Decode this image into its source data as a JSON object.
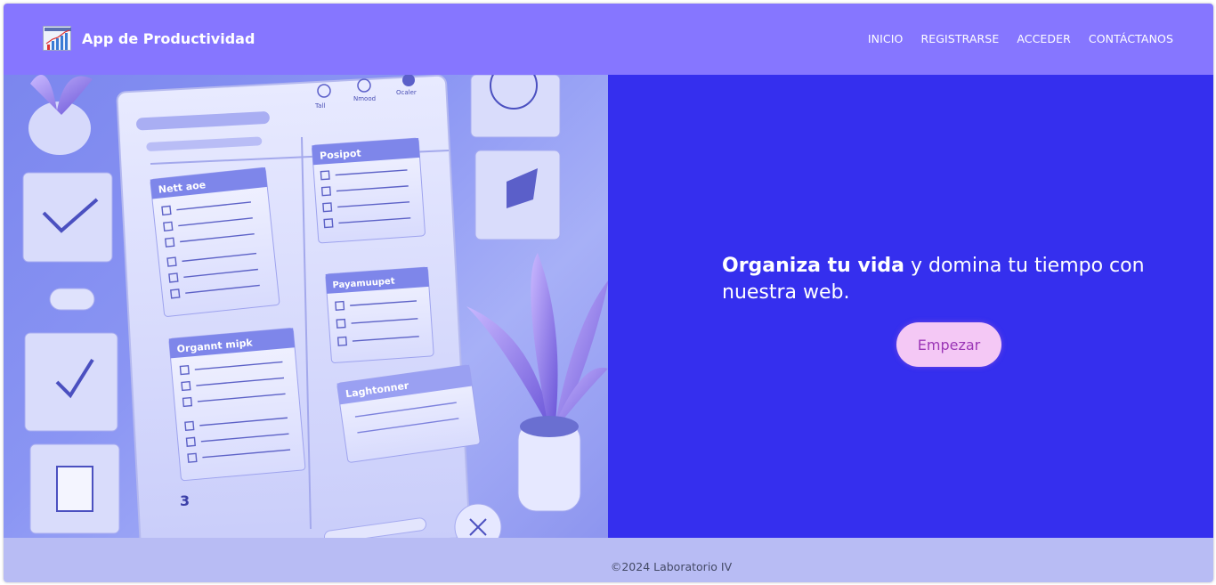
{
  "header": {
    "app_name": "App de Productividad",
    "logo_icon": "bar-chart-icon",
    "nav": [
      {
        "label": "INICIO"
      },
      {
        "label": "REGISTRARSE"
      },
      {
        "label": "ACCEDER"
      },
      {
        "label": "CONTÁCTANOS"
      }
    ]
  },
  "hero": {
    "headline_bold": "Organiza tu vida",
    "headline_rest": " y domina tu tiempo con nuestra web.",
    "cta_label": "Empezar"
  },
  "illustration": {
    "card_titles": [
      "Nett aoe",
      "Posipot",
      "Payamuupet",
      "Organnt mipk",
      "Laghtonner"
    ],
    "page_number": "3",
    "top_labels": [
      "Tall",
      "Nmood",
      "Ocaler"
    ]
  },
  "footer": {
    "copyright": "©2024 Laboratorio IV"
  },
  "colors": {
    "header_bg": "#8676ff",
    "hero_bg": "#352fee",
    "footer_bg": "#b8bcf4",
    "cta_bg": "#f4c8f5",
    "cta_text": "#9b36b6"
  }
}
